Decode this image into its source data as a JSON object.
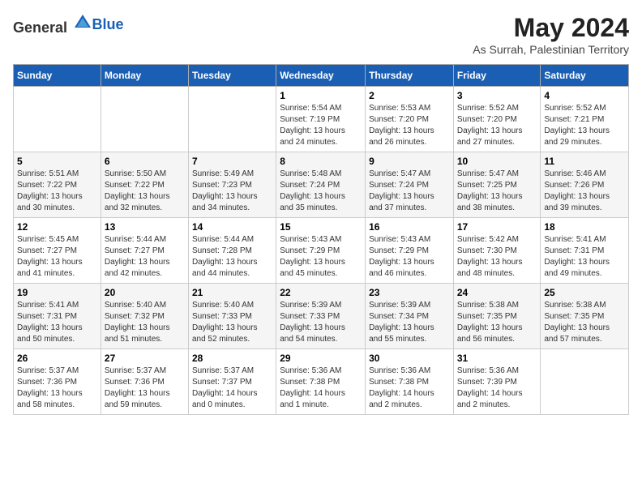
{
  "header": {
    "logo": {
      "text_general": "General",
      "text_blue": "Blue"
    },
    "month_year": "May 2024",
    "location": "As Surrah, Palestinian Territory"
  },
  "weekdays": [
    "Sunday",
    "Monday",
    "Tuesday",
    "Wednesday",
    "Thursday",
    "Friday",
    "Saturday"
  ],
  "weeks": [
    [
      {
        "day": "",
        "info": ""
      },
      {
        "day": "",
        "info": ""
      },
      {
        "day": "",
        "info": ""
      },
      {
        "day": "1",
        "info": "Sunrise: 5:54 AM\nSunset: 7:19 PM\nDaylight: 13 hours\nand 24 minutes."
      },
      {
        "day": "2",
        "info": "Sunrise: 5:53 AM\nSunset: 7:20 PM\nDaylight: 13 hours\nand 26 minutes."
      },
      {
        "day": "3",
        "info": "Sunrise: 5:52 AM\nSunset: 7:20 PM\nDaylight: 13 hours\nand 27 minutes."
      },
      {
        "day": "4",
        "info": "Sunrise: 5:52 AM\nSunset: 7:21 PM\nDaylight: 13 hours\nand 29 minutes."
      }
    ],
    [
      {
        "day": "5",
        "info": "Sunrise: 5:51 AM\nSunset: 7:22 PM\nDaylight: 13 hours\nand 30 minutes."
      },
      {
        "day": "6",
        "info": "Sunrise: 5:50 AM\nSunset: 7:22 PM\nDaylight: 13 hours\nand 32 minutes."
      },
      {
        "day": "7",
        "info": "Sunrise: 5:49 AM\nSunset: 7:23 PM\nDaylight: 13 hours\nand 34 minutes."
      },
      {
        "day": "8",
        "info": "Sunrise: 5:48 AM\nSunset: 7:24 PM\nDaylight: 13 hours\nand 35 minutes."
      },
      {
        "day": "9",
        "info": "Sunrise: 5:47 AM\nSunset: 7:24 PM\nDaylight: 13 hours\nand 37 minutes."
      },
      {
        "day": "10",
        "info": "Sunrise: 5:47 AM\nSunset: 7:25 PM\nDaylight: 13 hours\nand 38 minutes."
      },
      {
        "day": "11",
        "info": "Sunrise: 5:46 AM\nSunset: 7:26 PM\nDaylight: 13 hours\nand 39 minutes."
      }
    ],
    [
      {
        "day": "12",
        "info": "Sunrise: 5:45 AM\nSunset: 7:27 PM\nDaylight: 13 hours\nand 41 minutes."
      },
      {
        "day": "13",
        "info": "Sunrise: 5:44 AM\nSunset: 7:27 PM\nDaylight: 13 hours\nand 42 minutes."
      },
      {
        "day": "14",
        "info": "Sunrise: 5:44 AM\nSunset: 7:28 PM\nDaylight: 13 hours\nand 44 minutes."
      },
      {
        "day": "15",
        "info": "Sunrise: 5:43 AM\nSunset: 7:29 PM\nDaylight: 13 hours\nand 45 minutes."
      },
      {
        "day": "16",
        "info": "Sunrise: 5:43 AM\nSunset: 7:29 PM\nDaylight: 13 hours\nand 46 minutes."
      },
      {
        "day": "17",
        "info": "Sunrise: 5:42 AM\nSunset: 7:30 PM\nDaylight: 13 hours\nand 48 minutes."
      },
      {
        "day": "18",
        "info": "Sunrise: 5:41 AM\nSunset: 7:31 PM\nDaylight: 13 hours\nand 49 minutes."
      }
    ],
    [
      {
        "day": "19",
        "info": "Sunrise: 5:41 AM\nSunset: 7:31 PM\nDaylight: 13 hours\nand 50 minutes."
      },
      {
        "day": "20",
        "info": "Sunrise: 5:40 AM\nSunset: 7:32 PM\nDaylight: 13 hours\nand 51 minutes."
      },
      {
        "day": "21",
        "info": "Sunrise: 5:40 AM\nSunset: 7:33 PM\nDaylight: 13 hours\nand 52 minutes."
      },
      {
        "day": "22",
        "info": "Sunrise: 5:39 AM\nSunset: 7:33 PM\nDaylight: 13 hours\nand 54 minutes."
      },
      {
        "day": "23",
        "info": "Sunrise: 5:39 AM\nSunset: 7:34 PM\nDaylight: 13 hours\nand 55 minutes."
      },
      {
        "day": "24",
        "info": "Sunrise: 5:38 AM\nSunset: 7:35 PM\nDaylight: 13 hours\nand 56 minutes."
      },
      {
        "day": "25",
        "info": "Sunrise: 5:38 AM\nSunset: 7:35 PM\nDaylight: 13 hours\nand 57 minutes."
      }
    ],
    [
      {
        "day": "26",
        "info": "Sunrise: 5:37 AM\nSunset: 7:36 PM\nDaylight: 13 hours\nand 58 minutes."
      },
      {
        "day": "27",
        "info": "Sunrise: 5:37 AM\nSunset: 7:36 PM\nDaylight: 13 hours\nand 59 minutes."
      },
      {
        "day": "28",
        "info": "Sunrise: 5:37 AM\nSunset: 7:37 PM\nDaylight: 14 hours\nand 0 minutes."
      },
      {
        "day": "29",
        "info": "Sunrise: 5:36 AM\nSunset: 7:38 PM\nDaylight: 14 hours\nand 1 minute."
      },
      {
        "day": "30",
        "info": "Sunrise: 5:36 AM\nSunset: 7:38 PM\nDaylight: 14 hours\nand 2 minutes."
      },
      {
        "day": "31",
        "info": "Sunrise: 5:36 AM\nSunset: 7:39 PM\nDaylight: 14 hours\nand 2 minutes."
      },
      {
        "day": "",
        "info": ""
      }
    ]
  ]
}
